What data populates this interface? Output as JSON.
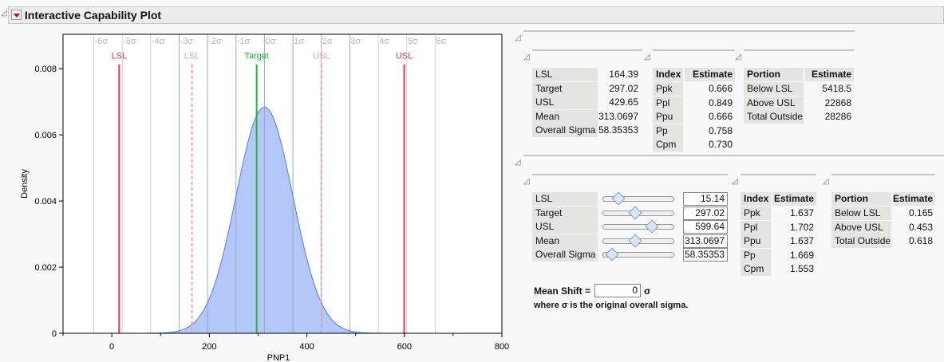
{
  "title": "Interactive Capability Plot",
  "chart_data": {
    "type": "area",
    "title": "",
    "xlabel": "PNP1",
    "ylabel": "Density",
    "xlim": [
      -100,
      800
    ],
    "ylim": [
      0,
      0.00904
    ],
    "xticks": [
      0,
      200,
      400,
      600,
      800
    ],
    "yticks": [
      0,
      0.002,
      0.004,
      0.006,
      0.008
    ],
    "ytick_labels": [
      "0",
      "0.002",
      "0.004",
      "0.006",
      "0.008"
    ],
    "distribution": {
      "name": "normal",
      "mean": 313.0697,
      "sigma": 58.35353
    },
    "sigma_labels": [
      "-6σ",
      "-5σ",
      "-4σ",
      "-3σ",
      "-2σ",
      "-1σ",
      "0σ",
      "1σ",
      "2σ",
      "3σ",
      "4σ",
      "5σ",
      "6σ"
    ],
    "sigma_base": {
      "mean": 313.0697,
      "sigma": 58.35353
    },
    "ref_lines": [
      {
        "label": "LSL",
        "value": 15.14,
        "style": "solid",
        "color": "#e8344f"
      },
      {
        "label": "LSL",
        "value": 164.39,
        "style": "dashed",
        "color": "#f7a0ad"
      },
      {
        "label": "Target",
        "value": 297.02,
        "style": "solid",
        "color": "#22b52e"
      },
      {
        "label": "USL",
        "value": 429.65,
        "style": "dashed",
        "color": "#f7a0ad"
      },
      {
        "label": "USL",
        "value": 599.64,
        "style": "solid",
        "color": "#e8344f"
      }
    ],
    "fill_color": "#b3c8f8",
    "line_color": "#4f7ee8"
  },
  "original": {
    "title": "Original",
    "summary": {
      "title": "Summary",
      "rows": [
        [
          "LSL",
          "164.39"
        ],
        [
          "Target",
          "297.02"
        ],
        [
          "USL",
          "429.65"
        ],
        [
          "Mean",
          "313.0697"
        ],
        [
          "Overall Sigma",
          "58.35353"
        ]
      ]
    },
    "capability": {
      "title": "Capability",
      "headers": [
        "Index",
        "Estimate"
      ],
      "rows": [
        [
          "Ppk",
          "0.666"
        ],
        [
          "Ppl",
          "0.849"
        ],
        [
          "Ppu",
          "0.666"
        ],
        [
          "Pp",
          "0.758"
        ],
        [
          "Cpm",
          "0.730"
        ]
      ]
    },
    "ppm": {
      "title": "Expected PPM",
      "headers": [
        "Portion",
        "Estimate"
      ],
      "rows": [
        [
          "Below LSL",
          "5418.5"
        ],
        [
          "Above USL",
          "22868"
        ],
        [
          "Total Outside",
          "28286"
        ]
      ]
    }
  },
  "new": {
    "title": "New",
    "summary": {
      "title": "Summary",
      "rows": [
        [
          "LSL",
          "15.14",
          0.22
        ],
        [
          "Target",
          "297.02",
          0.45
        ],
        [
          "USL",
          "599.64",
          0.69
        ],
        [
          "Mean",
          "313.0697",
          0.46
        ],
        [
          "Overall Sigma",
          "58.35353",
          0.13
        ]
      ]
    },
    "capability": {
      "title": "Capability",
      "headers": [
        "Index",
        "Estimate"
      ],
      "rows": [
        [
          "Ppk",
          "1.637"
        ],
        [
          "Ppl",
          "1.702"
        ],
        [
          "Ppu",
          "1.637"
        ],
        [
          "Pp",
          "1.669"
        ],
        [
          "Cpm",
          "1.553"
        ]
      ]
    },
    "ppm": {
      "title": "Expected PPM",
      "headers": [
        "Portion",
        "Estimate"
      ],
      "rows": [
        [
          "Below LSL",
          "0.165"
        ],
        [
          "Above USL",
          "0.453"
        ],
        [
          "Total Outside",
          "0.618"
        ]
      ]
    },
    "mean_shift_label": "Mean Shift =",
    "mean_shift_value": "0",
    "sigma_symbol": "σ",
    "note": "where σ is the original overall sigma."
  }
}
